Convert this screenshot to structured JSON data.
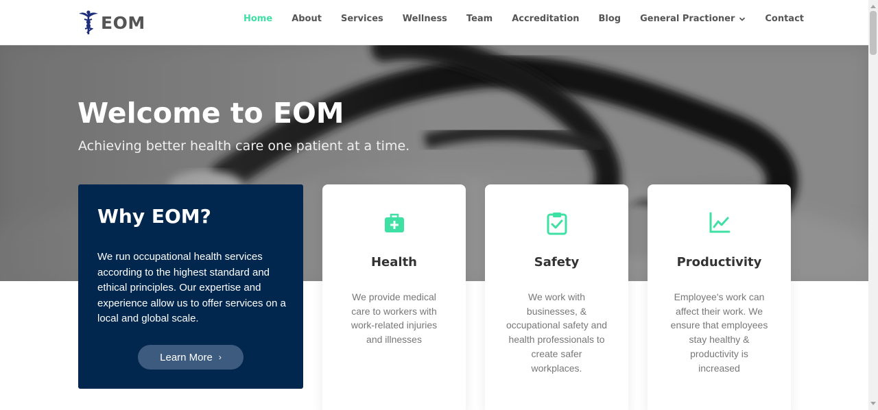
{
  "brand": {
    "name": "EOM",
    "logo_icon": "caduceus-icon"
  },
  "nav": {
    "items": [
      {
        "label": "Home",
        "active": true
      },
      {
        "label": "About"
      },
      {
        "label": "Services"
      },
      {
        "label": "Wellness"
      },
      {
        "label": "Team"
      },
      {
        "label": "Accreditation"
      },
      {
        "label": "Blog"
      },
      {
        "label": "General Practioner",
        "icon": "chevron-down-icon"
      },
      {
        "label": "Contact"
      }
    ],
    "active_color": "#3ee0a4"
  },
  "hero": {
    "title": "Welcome to EOM",
    "subtitle": "Achieving better health care one patient at a time.",
    "background": "stethoscope-photo"
  },
  "why": {
    "title": "Why EOM?",
    "text": "We run occupational health services according to the highest standard and ethical principles. Our expertise and experience allow us to offer services on a local and global scale.",
    "button_label": "Learn More",
    "button_icon": "chevron-right-icon",
    "bg_color": "#02274f"
  },
  "cards": [
    {
      "icon": "medical-kit-icon",
      "title": "Health",
      "text": "We provide medical care to workers with work-related injuries and illnesses"
    },
    {
      "icon": "clipboard-check-icon",
      "title": "Safety",
      "text": "We work with businesses, & occupational safety and health professionals to create safer workplaces."
    },
    {
      "icon": "line-chart-icon",
      "title": "Productivity",
      "text": "Employee's work can affect their work. We ensure that employees stay healthy & productivity is increased"
    }
  ],
  "accent_color": "#3ee0a4"
}
